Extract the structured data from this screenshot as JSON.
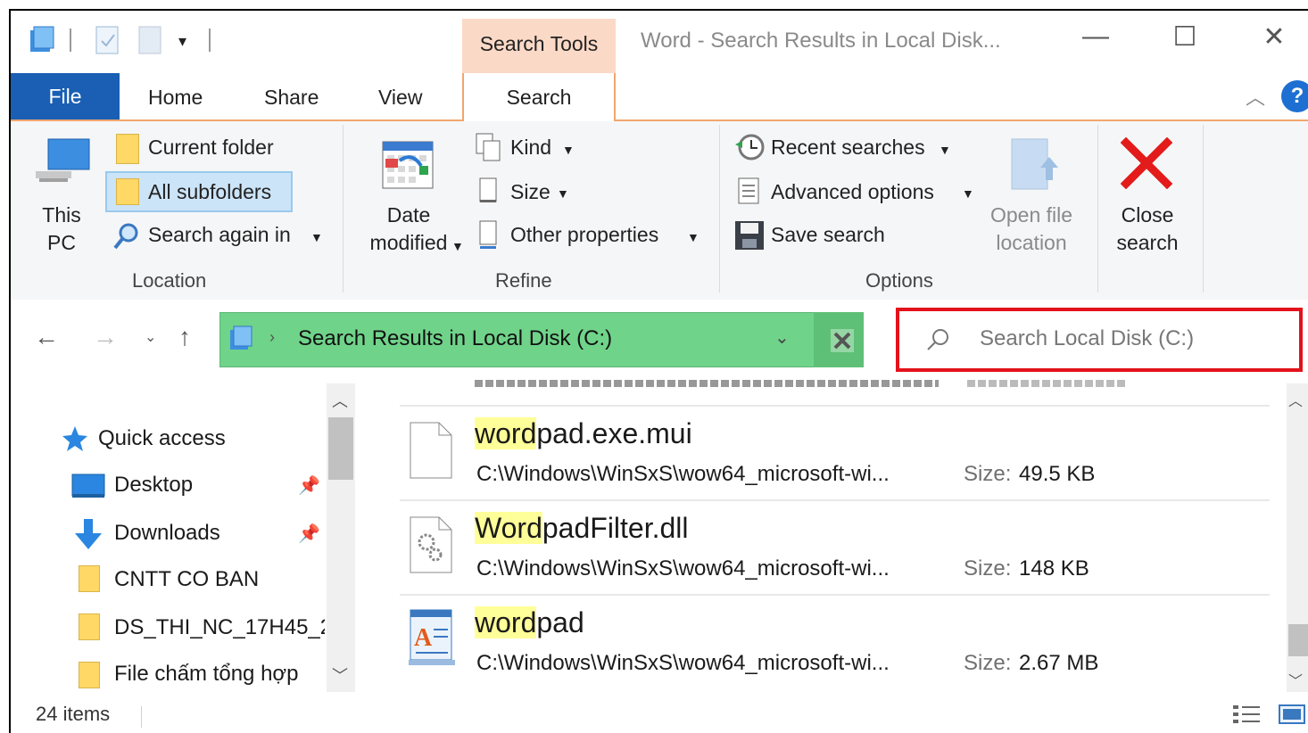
{
  "window": {
    "title": "Word - Search Results in Local Disk...",
    "context_tab": "Search Tools",
    "controls": {
      "minimize": "—",
      "maximize": "☐",
      "close": "✕"
    }
  },
  "tabs": {
    "file": "File",
    "home": "Home",
    "share": "Share",
    "view": "View",
    "search": "Search"
  },
  "ribbon": {
    "location": {
      "this_pc_line1": "This",
      "this_pc_line2": "PC",
      "current_folder": "Current folder",
      "all_subfolders": "All subfolders",
      "search_again_in": "Search again in",
      "group_label": "Location"
    },
    "refine": {
      "date_line1": "Date",
      "date_line2": "modified",
      "kind": "Kind",
      "size": "Size",
      "other_properties": "Other properties",
      "group_label": "Refine"
    },
    "options": {
      "recent_searches": "Recent searches",
      "advanced_options": "Advanced options",
      "save_search": "Save search",
      "open_file_line1": "Open file",
      "open_file_line2": "location",
      "group_label": "Options"
    },
    "close_search_line1": "Close",
    "close_search_line2": "search"
  },
  "address": {
    "path": "Search Results in Local Disk (C:)",
    "search_placeholder": "Search Local Disk (C:)"
  },
  "nav_pane": {
    "items": [
      {
        "label": "Quick access"
      },
      {
        "label": "Desktop"
      },
      {
        "label": "Downloads"
      },
      {
        "label": "CNTT CO BAN"
      },
      {
        "label": "DS_THI_NC_17H45_2"
      },
      {
        "label": "File chấm tổng hợp"
      }
    ]
  },
  "results": [
    {
      "name_hl": "word",
      "name_rest": "pad.exe.mui",
      "path": "C:\\Windows\\WinSxS\\wow64_microsoft-wi...",
      "size_label": "Size:",
      "size": "49.5 KB"
    },
    {
      "name_hl": "Word",
      "name_rest": "padFilter.dll",
      "path": "C:\\Windows\\WinSxS\\wow64_microsoft-wi...",
      "size_label": "Size:",
      "size": "148 KB"
    },
    {
      "name_hl": "word",
      "name_rest": "pad",
      "path": "C:\\Windows\\WinSxS\\wow64_microsoft-wi...",
      "size_label": "Size:",
      "size": "2.67 MB"
    }
  ],
  "status": {
    "item_count": "24 items"
  },
  "colors": {
    "accent": "#1a5fb4",
    "context": "#fbd9c7",
    "address_bg": "#70d38a",
    "highlight": "#ffff99",
    "callout": "#e3121b"
  }
}
